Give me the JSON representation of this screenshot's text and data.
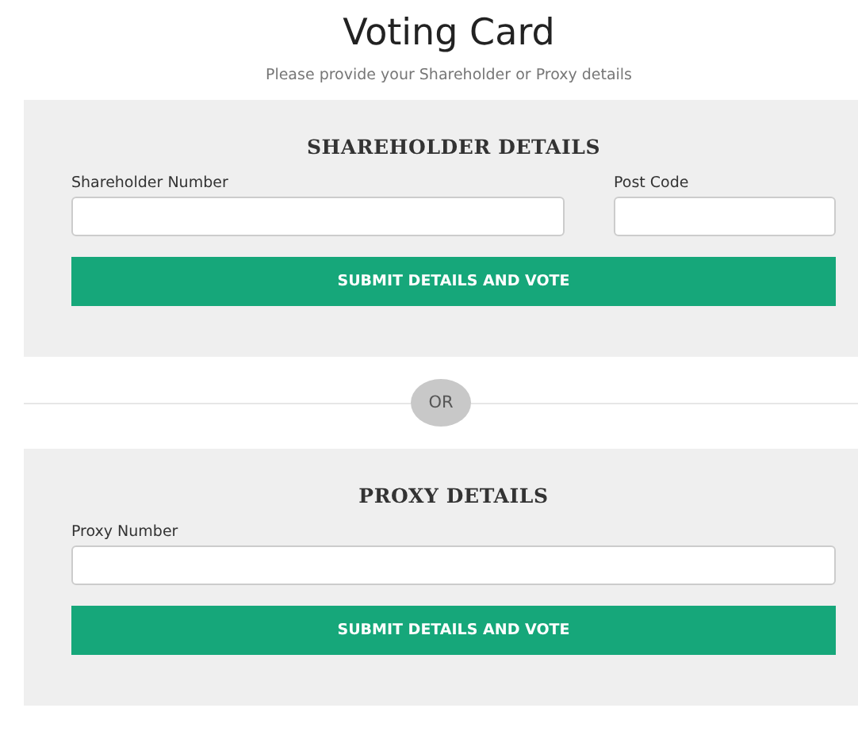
{
  "title": "Voting Card",
  "subtitle": "Please provide your Shareholder or Proxy details",
  "sections": [
    {
      "heading": "SHAREHOLDER DETAILS",
      "fields": [
        {
          "label": "Shareholder Number",
          "kind": "wide"
        },
        {
          "label": "Post Code",
          "kind": "narrow"
        }
      ],
      "button": "SUBMIT DETAILS AND VOTE"
    },
    {
      "heading": "PROXY DETAILS",
      "fields": [
        {
          "label": "Proxy Number",
          "kind": "wide"
        }
      ],
      "button": "SUBMIT DETAILS AND VOTE"
    }
  ],
  "separator": "OR"
}
